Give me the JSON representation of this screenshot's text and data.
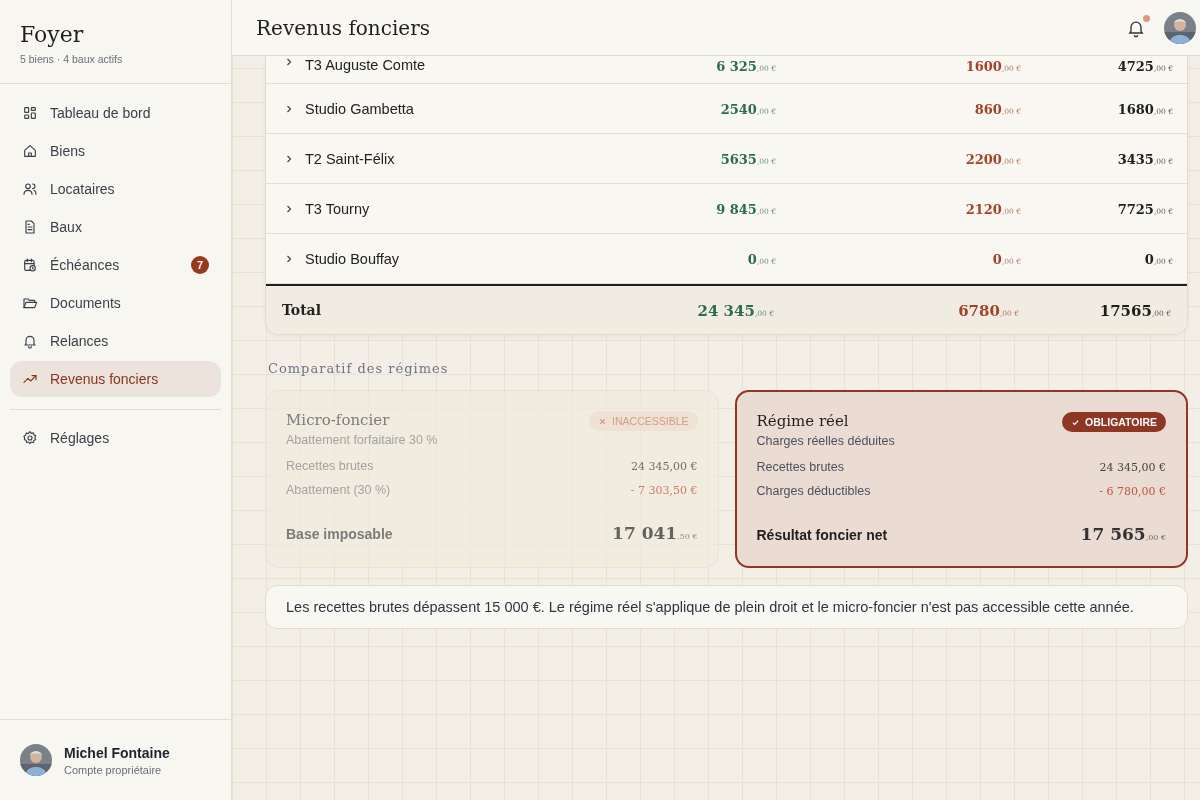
{
  "sidebar": {
    "brand": "Foyer",
    "subtitle": "5 biens · 4 baux actifs",
    "items": [
      {
        "label": "Tableau de bord",
        "selected": false
      },
      {
        "label": "Biens",
        "selected": false
      },
      {
        "label": "Locataires",
        "selected": false
      },
      {
        "label": "Baux",
        "selected": false
      },
      {
        "label": "Échéances",
        "selected": false,
        "badge": "7"
      },
      {
        "label": "Documents",
        "selected": false
      },
      {
        "label": "Relances",
        "selected": false
      },
      {
        "label": "Revenus fonciers",
        "selected": true
      }
    ],
    "settings": {
      "label": "Réglages",
      "selected": false
    },
    "user": {
      "name": "Michel Fontaine",
      "role": "Compte propriétaire"
    }
  },
  "header": {
    "title": "Revenus fonciers",
    "notification": true
  },
  "table": {
    "rows": [
      {
        "name": "T3 Auguste Comte",
        "recettes": "6 325",
        "recettes_cents": ",00 €",
        "charges": "1600",
        "charges_cents": ",00 €",
        "net": "4725",
        "net_cents": ",00 €"
      },
      {
        "name": "Studio Gambetta",
        "recettes": "2540",
        "recettes_cents": ",00 €",
        "charges": "860",
        "charges_cents": ",00 €",
        "net": "1680",
        "net_cents": ",00 €"
      },
      {
        "name": "T2 Saint-Félix",
        "recettes": "5635",
        "recettes_cents": ",00 €",
        "charges": "2200",
        "charges_cents": ",00 €",
        "net": "3435",
        "net_cents": ",00 €"
      },
      {
        "name": "T3 Tourny",
        "recettes": "9 845",
        "recettes_cents": ",00 €",
        "charges": "2120",
        "charges_cents": ",00 €",
        "net": "7725",
        "net_cents": ",00 €"
      },
      {
        "name": "Studio Bouffay",
        "recettes": "0",
        "recettes_cents": ",00 €",
        "charges": "0",
        "charges_cents": ",00 €",
        "net": "0",
        "net_cents": ",00 €"
      }
    ],
    "total": {
      "label": "Total",
      "recettes": "24 345",
      "recettes_cents": ",00 €",
      "charges": "6780",
      "charges_cents": ",00 €",
      "net": "17565",
      "net_cents": ",00 €"
    }
  },
  "comparison": {
    "title": "Comparatif des régimes",
    "regimes": [
      {
        "name": "Micro-foncier",
        "subtitle": "Abattement forfaitaire 30 %",
        "selected": false,
        "badge": "INACCESSIBLE",
        "lines": [
          {
            "label": "Recettes brutes",
            "value": "24 345,00 €",
            "kind": "plain"
          },
          {
            "label": "Abattement (30 %)",
            "value": "- 7 303,50 €",
            "kind": "minus"
          }
        ],
        "result": {
          "label": "Base imposable",
          "value": "17 041",
          "cents": ",50 €"
        }
      },
      {
        "name": "Régime réel",
        "subtitle": "Charges réelles déduites",
        "selected": true,
        "badge": "OBLIGATOIRE",
        "lines": [
          {
            "label": "Recettes brutes",
            "value": "24 345,00 €",
            "kind": "plain"
          },
          {
            "label": "Charges déductibles",
            "value": "- 6 780,00 €",
            "kind": "minus"
          }
        ],
        "result": {
          "label": "Résultat foncier net",
          "value": "17 565",
          "cents": ",00 €"
        }
      }
    ],
    "note": "Les recettes brutes dépassent 15 000 €. Le régime réel s'applique de plein droit et le micro-foncier n'est pas accessible cette année."
  }
}
